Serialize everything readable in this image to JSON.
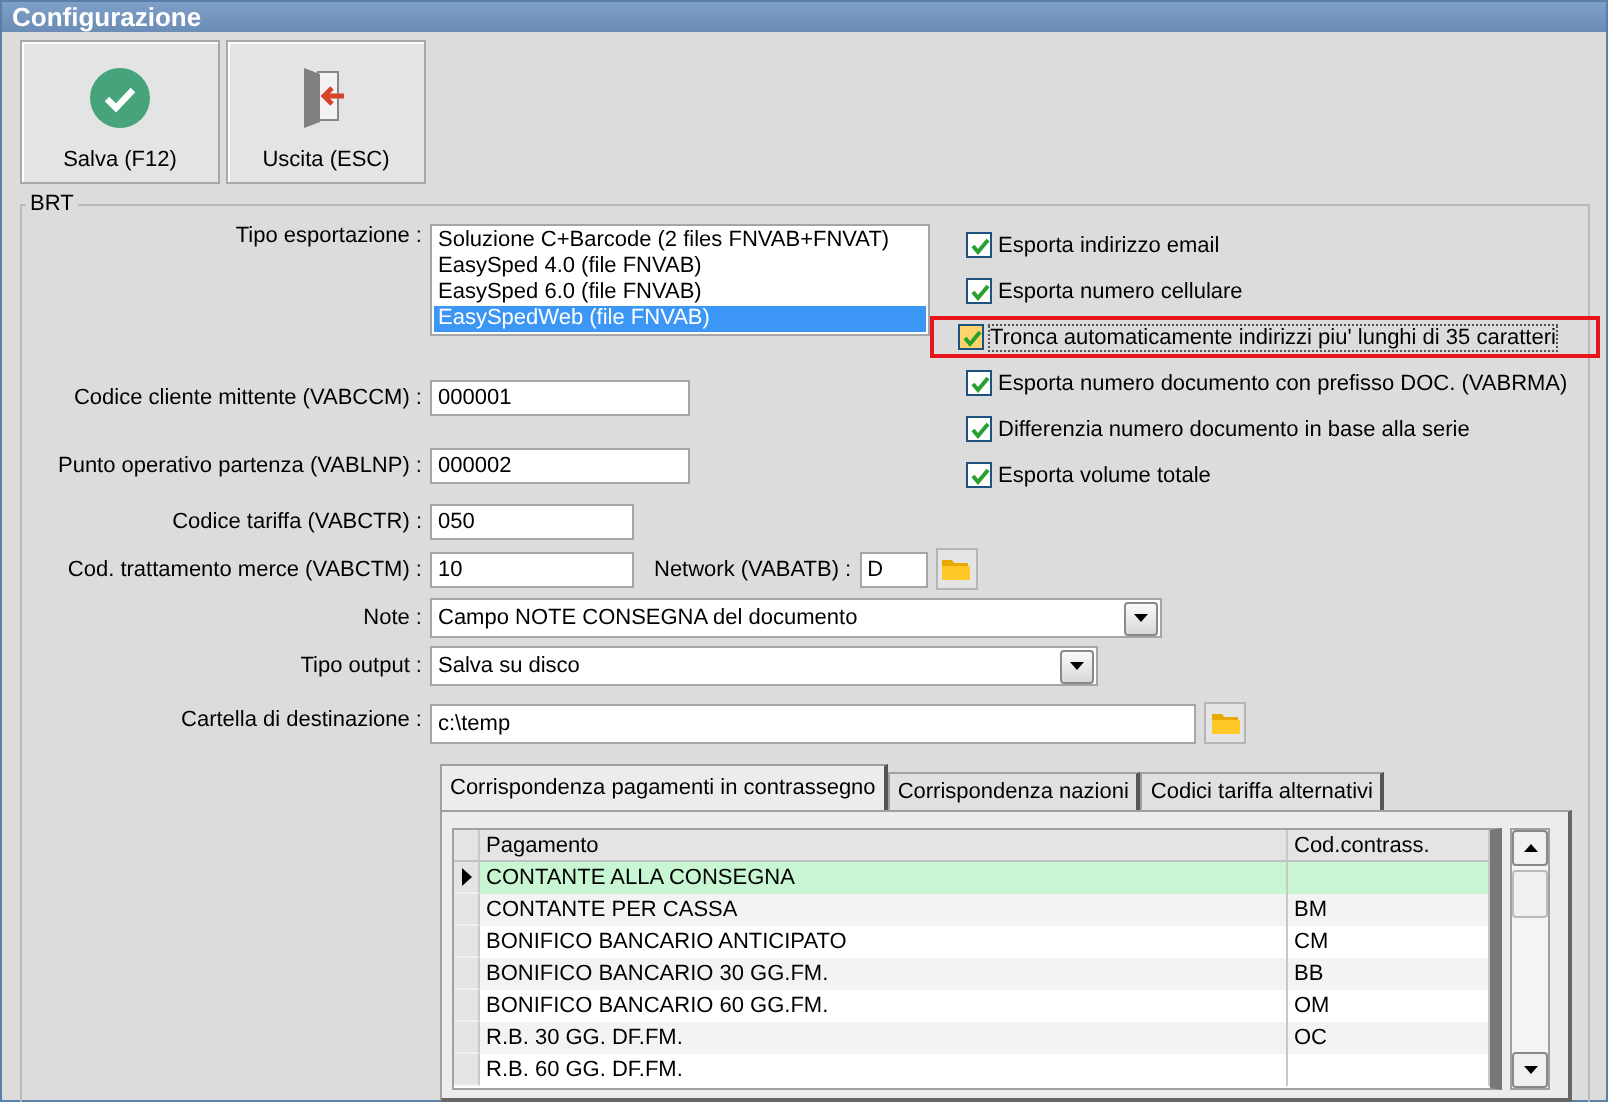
{
  "window": {
    "title": "Configurazione"
  },
  "toolbar": [
    {
      "kind": "save",
      "label": "Salva (F12)"
    },
    {
      "kind": "exit",
      "label": "Uscita (ESC)"
    }
  ],
  "group": {
    "title": "BRT"
  },
  "export_type": {
    "label": "Tipo esportazione :",
    "options": [
      {
        "label": "Soluzione C+Barcode (2 files FNVAB+FNVAT)",
        "selected": false
      },
      {
        "label": "EasySped 4.0 (file FNVAB)",
        "selected": false
      },
      {
        "label": "EasySped 6.0 (file FNVAB)",
        "selected": false
      },
      {
        "label": "EasySpedWeb (file FNVAB)",
        "selected": true
      }
    ]
  },
  "checkboxes": [
    {
      "label": "Esporta indirizzo email",
      "checked": true,
      "highlighted": false
    },
    {
      "label": "Esporta numero cellulare",
      "checked": true,
      "highlighted": false
    },
    {
      "label": "Tronca automaticamente indirizzi piu' lunghi di 35 caratteri",
      "checked": true,
      "highlighted": true
    },
    {
      "label": "Esporta numero documento con prefisso DOC. (VABRMA)",
      "checked": true,
      "highlighted": false
    },
    {
      "label": "Differenzia numero documento in base alla serie",
      "checked": true,
      "highlighted": false
    },
    {
      "label": "Esporta volume totale",
      "checked": true,
      "highlighted": false
    }
  ],
  "fields": [
    {
      "kind": "long",
      "label": "Codice cliente mittente (VABCCM) :",
      "value": "000001"
    },
    {
      "kind": "long",
      "label": "Punto operativo partenza (VABLNP) :",
      "value": "000002"
    },
    {
      "kind": "short",
      "label": "Codice tariffa (VABCTR) :",
      "value": "050"
    },
    {
      "kind": "pair",
      "label": "Cod. trattamento merce (VABCTM) :",
      "value": "10",
      "extra_label": "Network (VABATB) :",
      "extra_value": "D"
    },
    {
      "kind": "dropdown",
      "label": "Note :",
      "value": "Campo NOTE CONSEGNA del documento"
    },
    {
      "kind": "dropdown",
      "label": "Tipo output :",
      "value": "Salva su disco"
    },
    {
      "kind": "folder",
      "label": "Cartella di destinazione :",
      "value": "c:\\temp"
    }
  ],
  "tabs": [
    {
      "label": "Corrispondenza pagamenti in contrassegno",
      "selected": true
    },
    {
      "label": "Corrispondenza nazioni",
      "selected": false
    },
    {
      "label": "Codici tariffa alternativi",
      "selected": false
    }
  ],
  "table": {
    "columns": [
      "Pagamento",
      "Cod.contrass."
    ],
    "rows": [
      {
        "payment": "CONTANTE ALLA CONSEGNA",
        "selected": true
      },
      {
        "payment": "CONTANTE PER CASSA",
        "code": "BM",
        "selected": false
      },
      {
        "payment": "BONIFICO BANCARIO ANTICIPATO",
        "code": "CM",
        "selected": false
      },
      {
        "payment": "BONIFICO BANCARIO 30 GG.FM.",
        "code": "BB",
        "selected": false
      },
      {
        "payment": "BONIFICO BANCARIO 60 GG.FM.",
        "code": "OM",
        "selected": false
      },
      {
        "payment": "R.B. 30 GG. DF.FM.",
        "code": "OC",
        "selected": false
      },
      {
        "payment": "R.B. 60 GG. DF.FM.",
        "selected": false
      }
    ]
  }
}
